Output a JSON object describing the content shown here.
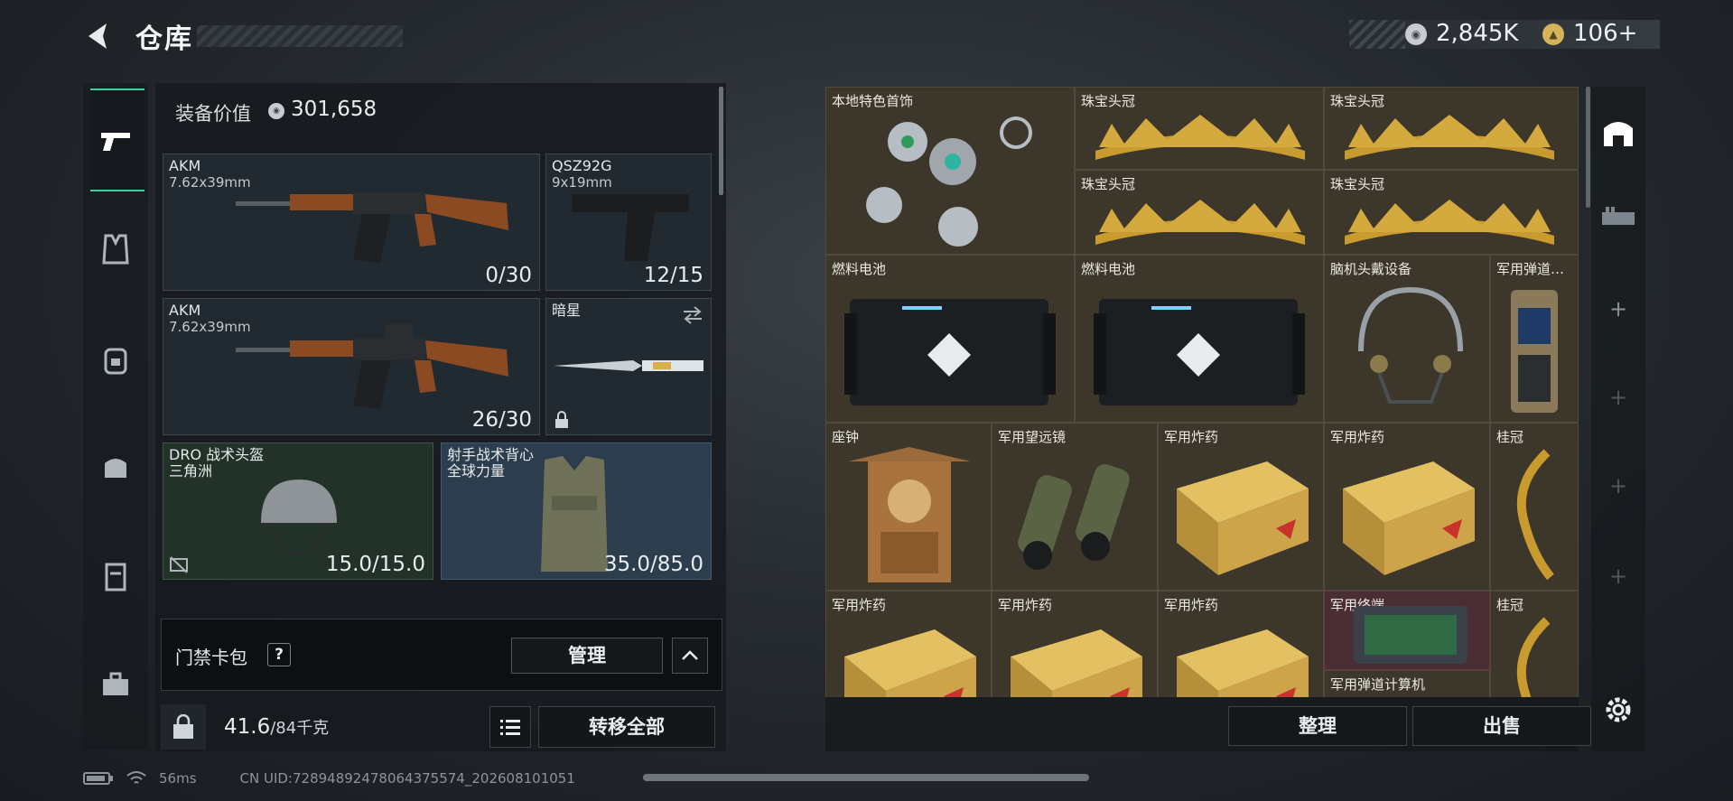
{
  "header": {
    "title": "仓库"
  },
  "currency": [
    {
      "name": "silver-coin-icon",
      "value": "2,845K"
    },
    {
      "name": "gold-coin-icon",
      "value": "106+"
    }
  ],
  "equipment": {
    "label": "装备价值",
    "value": "301,658",
    "slots": [
      {
        "name": "AKM",
        "sub": "7.62x39mm",
        "ammo": "0/30"
      },
      {
        "name": "QSZ92G",
        "sub": "9x19mm",
        "ammo": "12/15"
      },
      {
        "name": "AKM",
        "sub": "7.62x39mm",
        "ammo": "26/30"
      },
      {
        "name": "暗星",
        "sub": "",
        "ammo": ""
      },
      {
        "name": "DRO 战术头盔\n三角洲",
        "sub": "",
        "ammo": "15.0/15.0"
      },
      {
        "name": "射手战术背心\n全球力量",
        "sub": "",
        "ammo": "35.0/85.0"
      }
    ]
  },
  "keycard": {
    "label": "门禁卡包",
    "help": "?",
    "manage": "管理"
  },
  "weight": {
    "value": "41.6",
    "unit": "/84千克"
  },
  "transfer_all": "转移全部",
  "storage": {
    "items": [
      "本地特色首饰",
      "珠宝头冠",
      "珠宝头冠",
      "珠宝头冠",
      "珠宝头冠",
      "燃料电池",
      "燃料电池",
      "脑机头戴设备",
      "军用弹道…",
      "座钟",
      "军用望远镜",
      "军用炸药",
      "军用炸药",
      "桂冠",
      "军用炸药",
      "军用炸药",
      "军用炸药",
      "军用终端",
      "军用弹道计算机",
      "桂冠"
    ],
    "sort": "整理",
    "sell": "出售"
  },
  "status": {
    "ping": "56ms",
    "uid": "CN UID:7289489247806437557​4_202608101051"
  }
}
